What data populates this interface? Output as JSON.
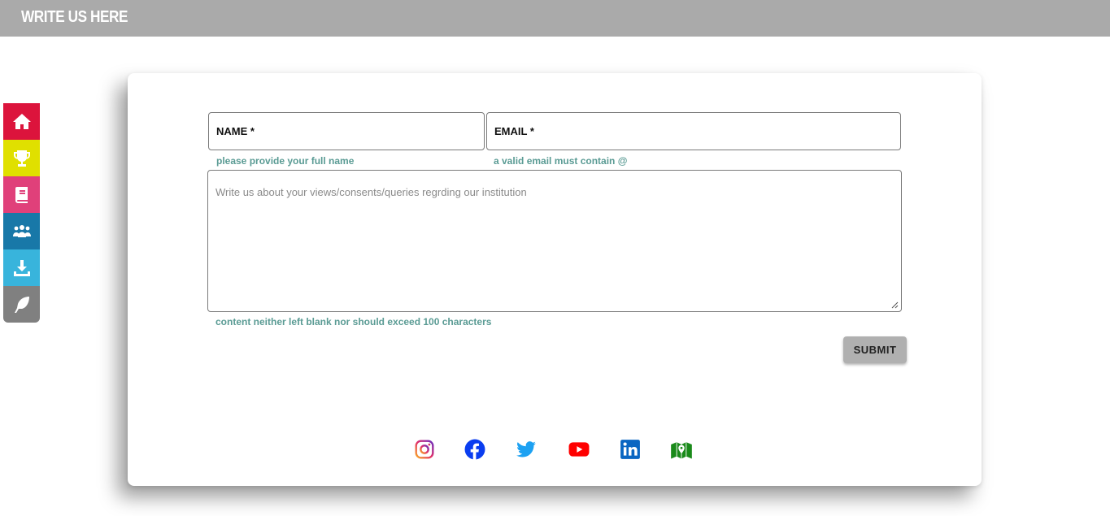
{
  "header": {
    "title": "WRITE US HERE"
  },
  "sidebar": {
    "items": [
      {
        "icon": "home-icon",
        "color": "#dc143c"
      },
      {
        "icon": "trophy-icon",
        "color": "#e0e000"
      },
      {
        "icon": "book-icon",
        "color": "#e0407a"
      },
      {
        "icon": "users-icon",
        "color": "#1878a8"
      },
      {
        "icon": "download-icon",
        "color": "#38b4dc"
      },
      {
        "icon": "feather-icon",
        "color": "#808080"
      }
    ]
  },
  "form": {
    "name_label": "NAME *",
    "name_hint": "please provide your full name",
    "email_label": "EMAIL *",
    "email_hint": "a valid email must contain @",
    "message_placeholder": "Write us about your views/consents/queries regrding our institution",
    "message_hint": "content neither left blank nor should exceed 100 characters",
    "submit_label": "SUBMIT"
  },
  "social": [
    {
      "icon": "instagram-icon"
    },
    {
      "icon": "facebook-icon",
      "color": "#0a3df0"
    },
    {
      "icon": "twitter-icon",
      "color": "#1da1f2"
    },
    {
      "icon": "youtube-icon",
      "color": "#ff0000"
    },
    {
      "icon": "linkedin-icon",
      "color": "#0a66c2"
    },
    {
      "icon": "map-icon",
      "color": "#1a8a1a"
    }
  ],
  "colors": {
    "hint": "#5a9b94",
    "header_bg": "#aaaaaa",
    "submit_bg": "#b0b0b0"
  }
}
